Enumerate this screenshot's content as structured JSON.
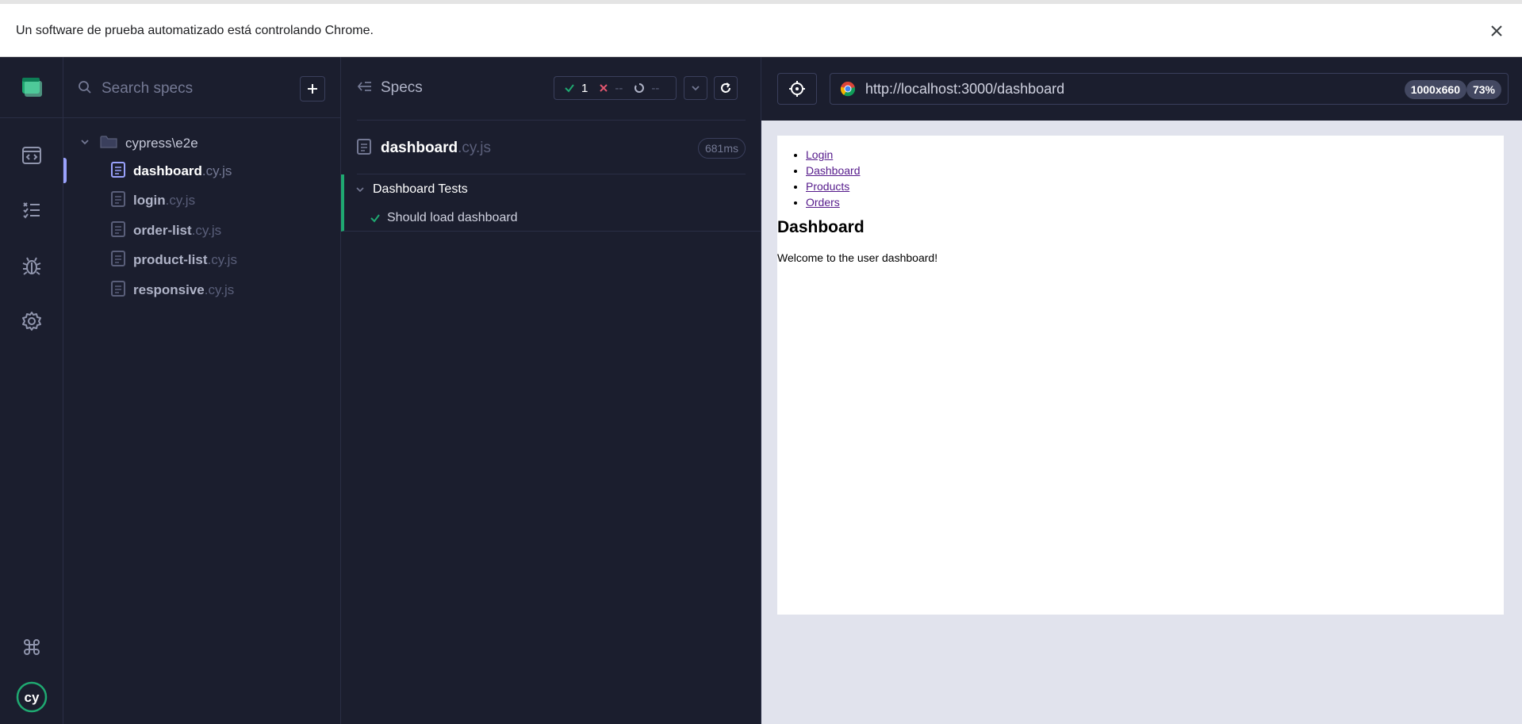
{
  "infobar": {
    "message": "Un software de prueba automatizado está controlando Chrome."
  },
  "sidebar": {
    "icons": [
      "cypress-app-logo-icon",
      "specs-icon",
      "runs-icon",
      "debug-icon",
      "settings-icon",
      "keyboard-shortcuts-icon",
      "cypress-logo-icon"
    ]
  },
  "specs_panel": {
    "search_placeholder": "Search specs",
    "folder": "cypress\\e2e",
    "files": [
      {
        "name": "dashboard",
        "ext": ".cy.js",
        "active": true
      },
      {
        "name": "login",
        "ext": ".cy.js"
      },
      {
        "name": "order-list",
        "ext": ".cy.js"
      },
      {
        "name": "product-list",
        "ext": ".cy.js"
      },
      {
        "name": "responsive",
        "ext": ".cy.js"
      }
    ]
  },
  "reporter": {
    "specs_label": "Specs",
    "stats": {
      "passed": "1",
      "failed": "--",
      "pending": "--"
    },
    "file": {
      "name": "dashboard",
      "ext": ".cy.js",
      "duration": "681ms"
    },
    "suite": "Dashboard Tests",
    "test": "Should load dashboard"
  },
  "aut": {
    "url": "http://localhost:3000/dashboard",
    "viewport": "1000x660",
    "zoom": "73%",
    "page": {
      "nav": [
        "Login",
        "Dashboard",
        "Products",
        "Orders"
      ],
      "heading": "Dashboard",
      "text": "Welcome to the user dashboard!"
    }
  },
  "colors": {
    "background": "#1b1e2e",
    "pass": "#1fa971",
    "fail": "#e45770",
    "accent": "#9aa2fc"
  }
}
